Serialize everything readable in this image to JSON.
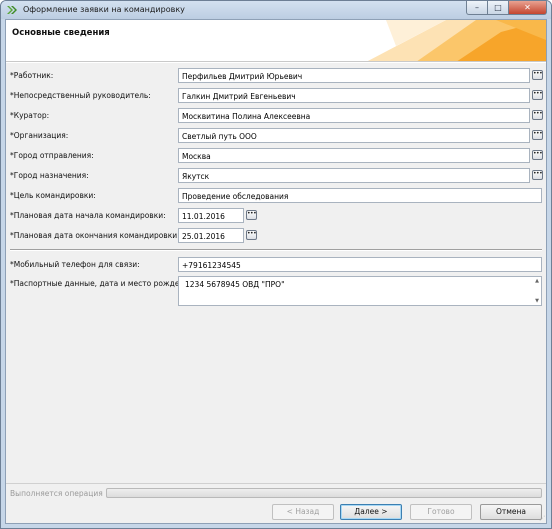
{
  "window": {
    "title": "Оформление заявки на командировку",
    "buttons": {
      "minimize": "–",
      "maximize": "□",
      "close": "✕"
    }
  },
  "banner": {
    "title": "Основные сведения",
    "accent_colors": [
      "#f7a52a",
      "#fbc66a",
      "#fde2b4"
    ]
  },
  "form": {
    "employee": {
      "label": "*Работник:",
      "value": "Перфильев Дмитрий Юрьевич"
    },
    "manager": {
      "label": "*Непосредственный руководитель:",
      "value": "Галкин Дмитрий Евгеньевич"
    },
    "curator": {
      "label": "*Куратор:",
      "value": "Москвитина Полина Алексеевна"
    },
    "organization": {
      "label": "*Организация:",
      "value": "Светлый путь ООО"
    },
    "city_from": {
      "label": "*Город отправления:",
      "value": "Москва"
    },
    "city_to": {
      "label": "*Город назначения:",
      "value": "Якутск"
    },
    "purpose": {
      "label": "*Цель командировки:",
      "value": "Проведение обследования"
    },
    "date_start": {
      "label": "*Плановая дата начала командировки:",
      "value": "11.01.2016"
    },
    "date_end": {
      "label": "*Плановая дата окончания командировки:",
      "value": "25.01.2016"
    },
    "phone": {
      "label": "*Мобильный телефон для связи:",
      "value": "+79161234545"
    },
    "passport": {
      "label": "*Паспортные данные, дата и место рождения:",
      "value": "1234 5678945 ОВД \"ПРО\""
    },
    "picker_glyph": "•••"
  },
  "status": {
    "progress_label": "Выполняется операция",
    "progress_value": 0
  },
  "buttons": {
    "back": "< Назад",
    "next": "Далее >",
    "done": "Готово",
    "cancel": "Отмена"
  }
}
